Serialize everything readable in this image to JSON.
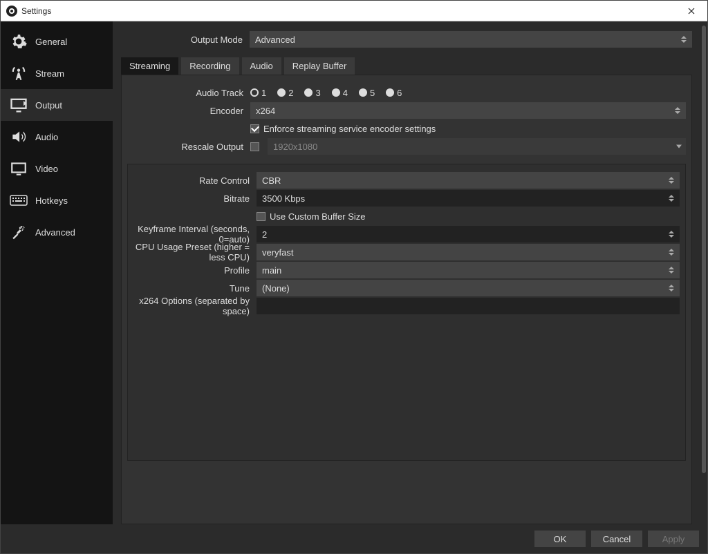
{
  "window": {
    "title": "Settings"
  },
  "sidebar": {
    "items": [
      {
        "label": "General"
      },
      {
        "label": "Stream"
      },
      {
        "label": "Output"
      },
      {
        "label": "Audio"
      },
      {
        "label": "Video"
      },
      {
        "label": "Hotkeys"
      },
      {
        "label": "Advanced"
      }
    ],
    "active_index": 2
  },
  "output_mode": {
    "label": "Output Mode",
    "value": "Advanced"
  },
  "tabs": [
    {
      "label": "Streaming"
    },
    {
      "label": "Recording"
    },
    {
      "label": "Audio"
    },
    {
      "label": "Replay Buffer"
    }
  ],
  "tabs_active_index": 0,
  "streaming": {
    "audio_track": {
      "label": "Audio Track",
      "options": [
        "1",
        "2",
        "3",
        "4",
        "5",
        "6"
      ],
      "selected": "1"
    },
    "encoder": {
      "label": "Encoder",
      "value": "x264"
    },
    "enforce": {
      "label": "Enforce streaming service encoder settings",
      "checked": true
    },
    "rescale": {
      "label": "Rescale Output",
      "checked": false,
      "placeholder": "1920x1080"
    },
    "rate_control": {
      "label": "Rate Control",
      "value": "CBR"
    },
    "bitrate": {
      "label": "Bitrate",
      "value": "3500 Kbps"
    },
    "custom_buffer": {
      "label": "Use Custom Buffer Size",
      "checked": false
    },
    "keyframe": {
      "label": "Keyframe Interval (seconds, 0=auto)",
      "value": "2"
    },
    "cpu_preset": {
      "label": "CPU Usage Preset (higher = less CPU)",
      "value": "veryfast"
    },
    "profile": {
      "label": "Profile",
      "value": "main"
    },
    "tune": {
      "label": "Tune",
      "value": "(None)"
    },
    "x264opts": {
      "label": "x264 Options (separated by space)",
      "value": ""
    }
  },
  "footer": {
    "ok": "OK",
    "cancel": "Cancel",
    "apply": "Apply"
  }
}
